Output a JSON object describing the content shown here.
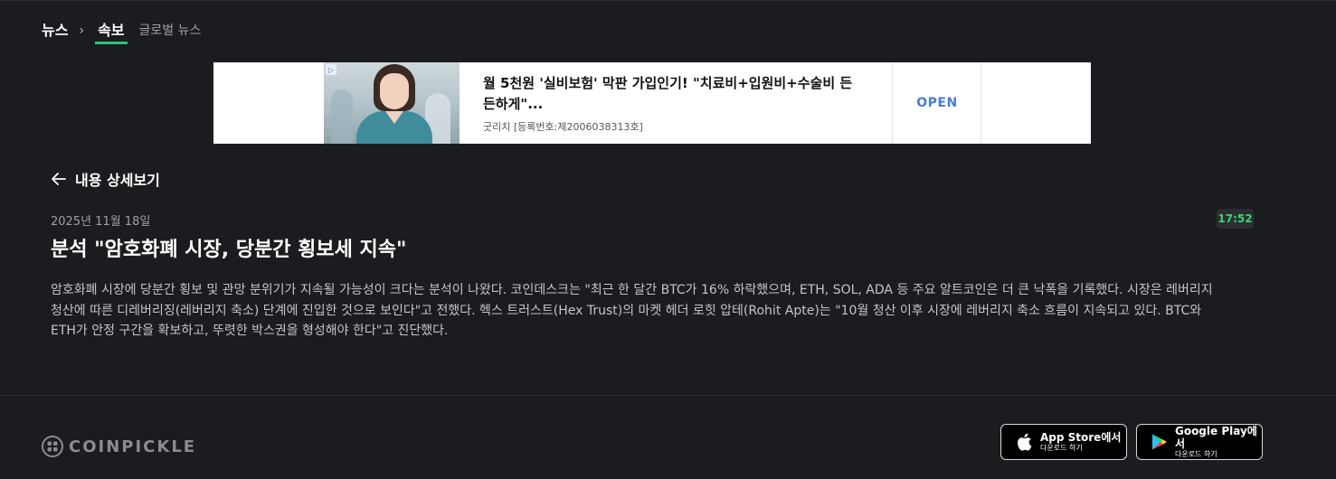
{
  "nav": {
    "root": "뉴스",
    "separator": "›",
    "active_tab": "속보",
    "other_tab": "글로벌 뉴스"
  },
  "ad": {
    "title": "월 5천원 '실비보험' 막판 가입인기! \"치료비+입원비+수술비 든든하게\"...",
    "source": "굿리치 [등록번호:제2006038313호]",
    "cta": "OPEN",
    "marker": "▷"
  },
  "article": {
    "back_label": "내용 상세보기",
    "date": "2025년 11월 18일",
    "time": "17:52",
    "headline": "분석 \"암호화폐 시장, 당분간 횡보세 지속\"",
    "body": "암호화폐 시장에 당분간 횡보 및 관망 분위기가 지속될 가능성이 크다는 분석이 나왔다. 코인데스크는 \"최근 한 달간 BTC가 16% 하락했으며, ETH, SOL, ADA 등 주요 알트코인은 더 큰 낙폭을 기록했다. 시장은 레버리지 청산에 따른 디레버리징(레버리지 축소) 단계에 진입한 것으로 보인다\"고 전했다. 헥스 트러스트(Hex Trust)의 마켓 헤더 로힛 압테(Rohit Apte)는 \"10월 청산 이후 시장에 레버리지 축소 흐름이 지속되고 있다. BTC와 ETH가 안정 구간을 확보하고, 뚜렷한 박스권을 형성해야 한다\"고 진단했다."
  },
  "footer": {
    "logo_text": "COINPICKLE",
    "app_store": {
      "main": "App Store에서",
      "sub": "다운로드 하기"
    },
    "google_play": {
      "main": "Google Play에서",
      "sub": "다운로드 하기"
    }
  },
  "colors": {
    "background": "#1b1c20",
    "accent_green": "#28c76f",
    "time_green": "#3fd36e",
    "ad_cta_blue": "#4a7bd6"
  },
  "icons": [
    "back-arrow-icon",
    "apple-icon",
    "google-play-icon",
    "coinpickle-logo-icon"
  ]
}
